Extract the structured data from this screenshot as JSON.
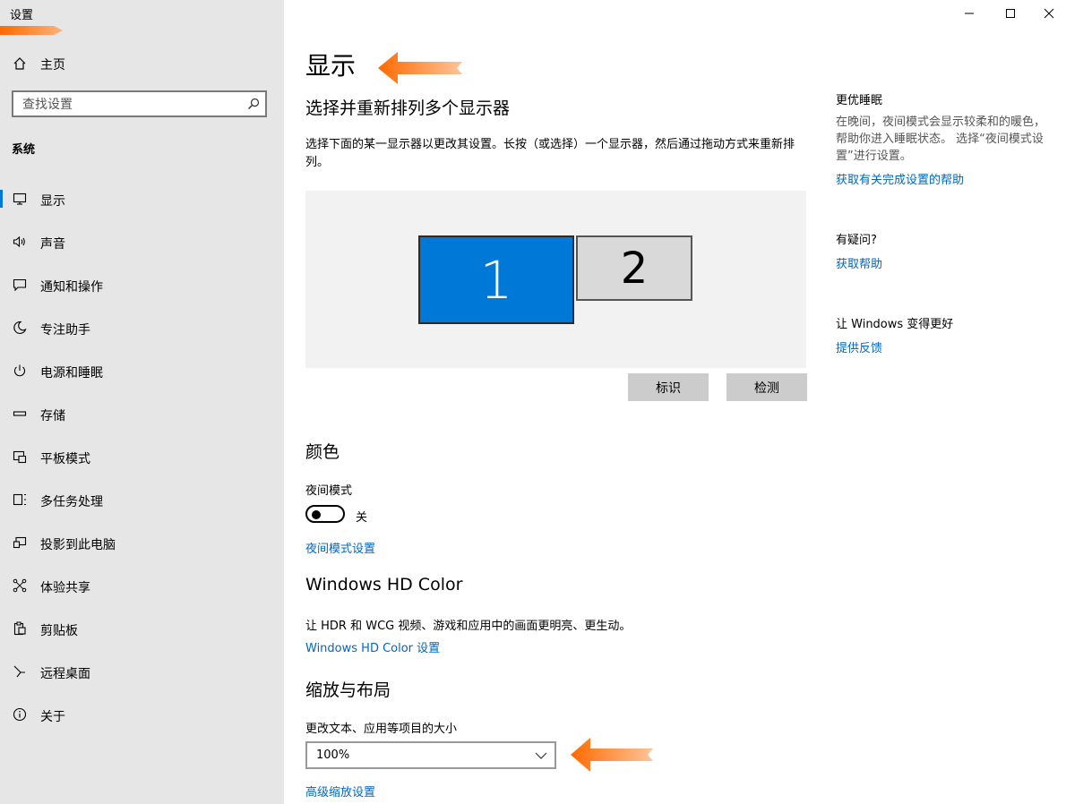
{
  "app": {
    "title": "设置"
  },
  "sidebar": {
    "home": "主页",
    "search_placeholder": "查找设置",
    "section": "系统",
    "items": [
      {
        "label": "显示",
        "icon": "monitor-icon"
      },
      {
        "label": "声音",
        "icon": "speaker-icon"
      },
      {
        "label": "通知和操作",
        "icon": "message-icon"
      },
      {
        "label": "专注助手",
        "icon": "moon-icon"
      },
      {
        "label": "电源和睡眠",
        "icon": "power-icon"
      },
      {
        "label": "存储",
        "icon": "storage-icon"
      },
      {
        "label": "平板模式",
        "icon": "tablet-icon"
      },
      {
        "label": "多任务处理",
        "icon": "multitask-icon"
      },
      {
        "label": "投影到此电脑",
        "icon": "project-icon"
      },
      {
        "label": "体验共享",
        "icon": "share-icon"
      },
      {
        "label": "剪贴板",
        "icon": "clipboard-icon"
      },
      {
        "label": "远程桌面",
        "icon": "remote-icon"
      },
      {
        "label": "关于",
        "icon": "info-icon"
      }
    ],
    "active_index": 0
  },
  "main": {
    "title": "显示",
    "arrange": {
      "title": "选择并重新排列多个显示器",
      "description": "选择下面的某一显示器以更改其设置。长按（或选择）一个显示器，然后通过拖动方式来重新排列。",
      "monitor_1": "1",
      "monitor_2": "2",
      "identify_button": "标识",
      "detect_button": "检测"
    },
    "color": {
      "title": "颜色",
      "night_mode_label": "夜间模式",
      "night_mode_state": "关",
      "night_mode_settings_link": "夜间模式设置"
    },
    "hdr": {
      "title": "Windows HD Color",
      "description": "让 HDR 和 WCG 视频、游戏和应用中的画面更明亮、更生动。",
      "settings_link": "Windows HD Color 设置"
    },
    "scale": {
      "title": "缩放与布局",
      "size_label": "更改文本、应用等项目的大小",
      "size_value": "100%",
      "advanced_link": "高级缩放设置"
    }
  },
  "right_panel": {
    "sleep_title": "更优睡眠",
    "sleep_desc": "在晚间，夜间模式会显示较柔和的暖色，帮助你进入睡眠状态。 选择“夜间模式设置”进行设置。",
    "sleep_link": "获取有关完成设置的帮助",
    "question_title": "有疑问?",
    "question_link": "获取帮助",
    "feedback_title": "让 Windows 变得更好",
    "feedback_link": "提供反馈"
  },
  "colors": {
    "accent": "#0078d7",
    "link": "#0067c0",
    "sidebar_bg": "#e6e6e6",
    "annotation": "#ff6a00"
  }
}
